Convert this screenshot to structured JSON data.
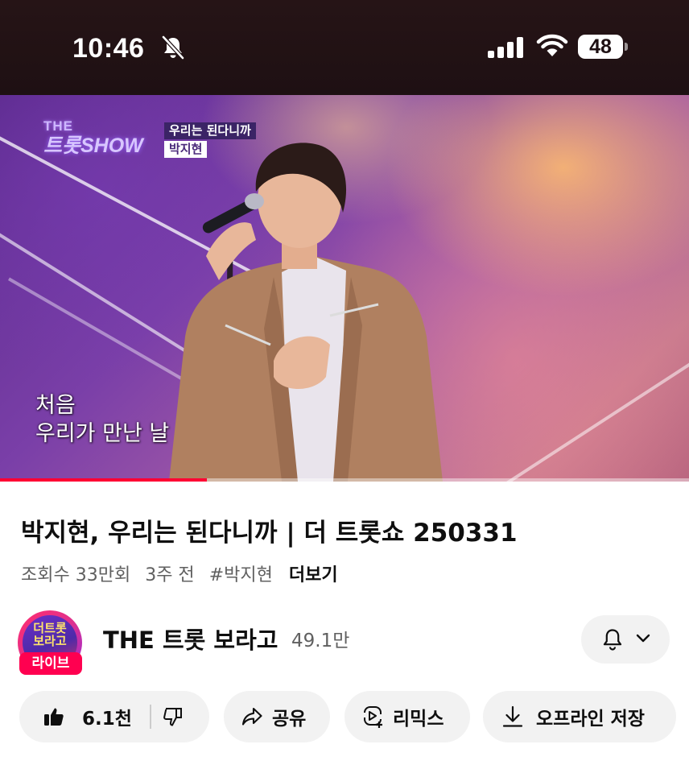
{
  "status_bar": {
    "time": "10:46",
    "battery": "48",
    "icons": [
      "bell-off-icon",
      "signal-icon",
      "wifi-icon",
      "battery-icon"
    ]
  },
  "video": {
    "overlay": {
      "show_logo_top": "THE",
      "show_logo_name": "트롯SHOW",
      "song_badge": "우리는 된다니까",
      "singer_badge": "박지현"
    },
    "subtitle_line1": "처음",
    "subtitle_line2": "우리가 만난 날",
    "progress_fraction": 0.3
  },
  "details": {
    "title": "박지현, 우리는 된다니까 | 더 트롯쇼 250331",
    "views": "조회수 33만회",
    "age": "3주 전",
    "hashtag": "#박지현",
    "more_label": "더보기"
  },
  "channel": {
    "avatar_text_line1": "더트롯",
    "avatar_text_line2": "보라고",
    "live_badge": "라이브",
    "name": "THE 트롯 보라고",
    "subscribers": "49.1만"
  },
  "actions": {
    "like_count": "6.1천",
    "share_label": "공유",
    "remix_label": "리믹스",
    "download_label": "오프라인 저장"
  },
  "colors": {
    "accent": "#ff0033",
    "live_badge": "#ff0050",
    "pill_background": "#f2f2f2",
    "secondary_text": "#606060"
  }
}
